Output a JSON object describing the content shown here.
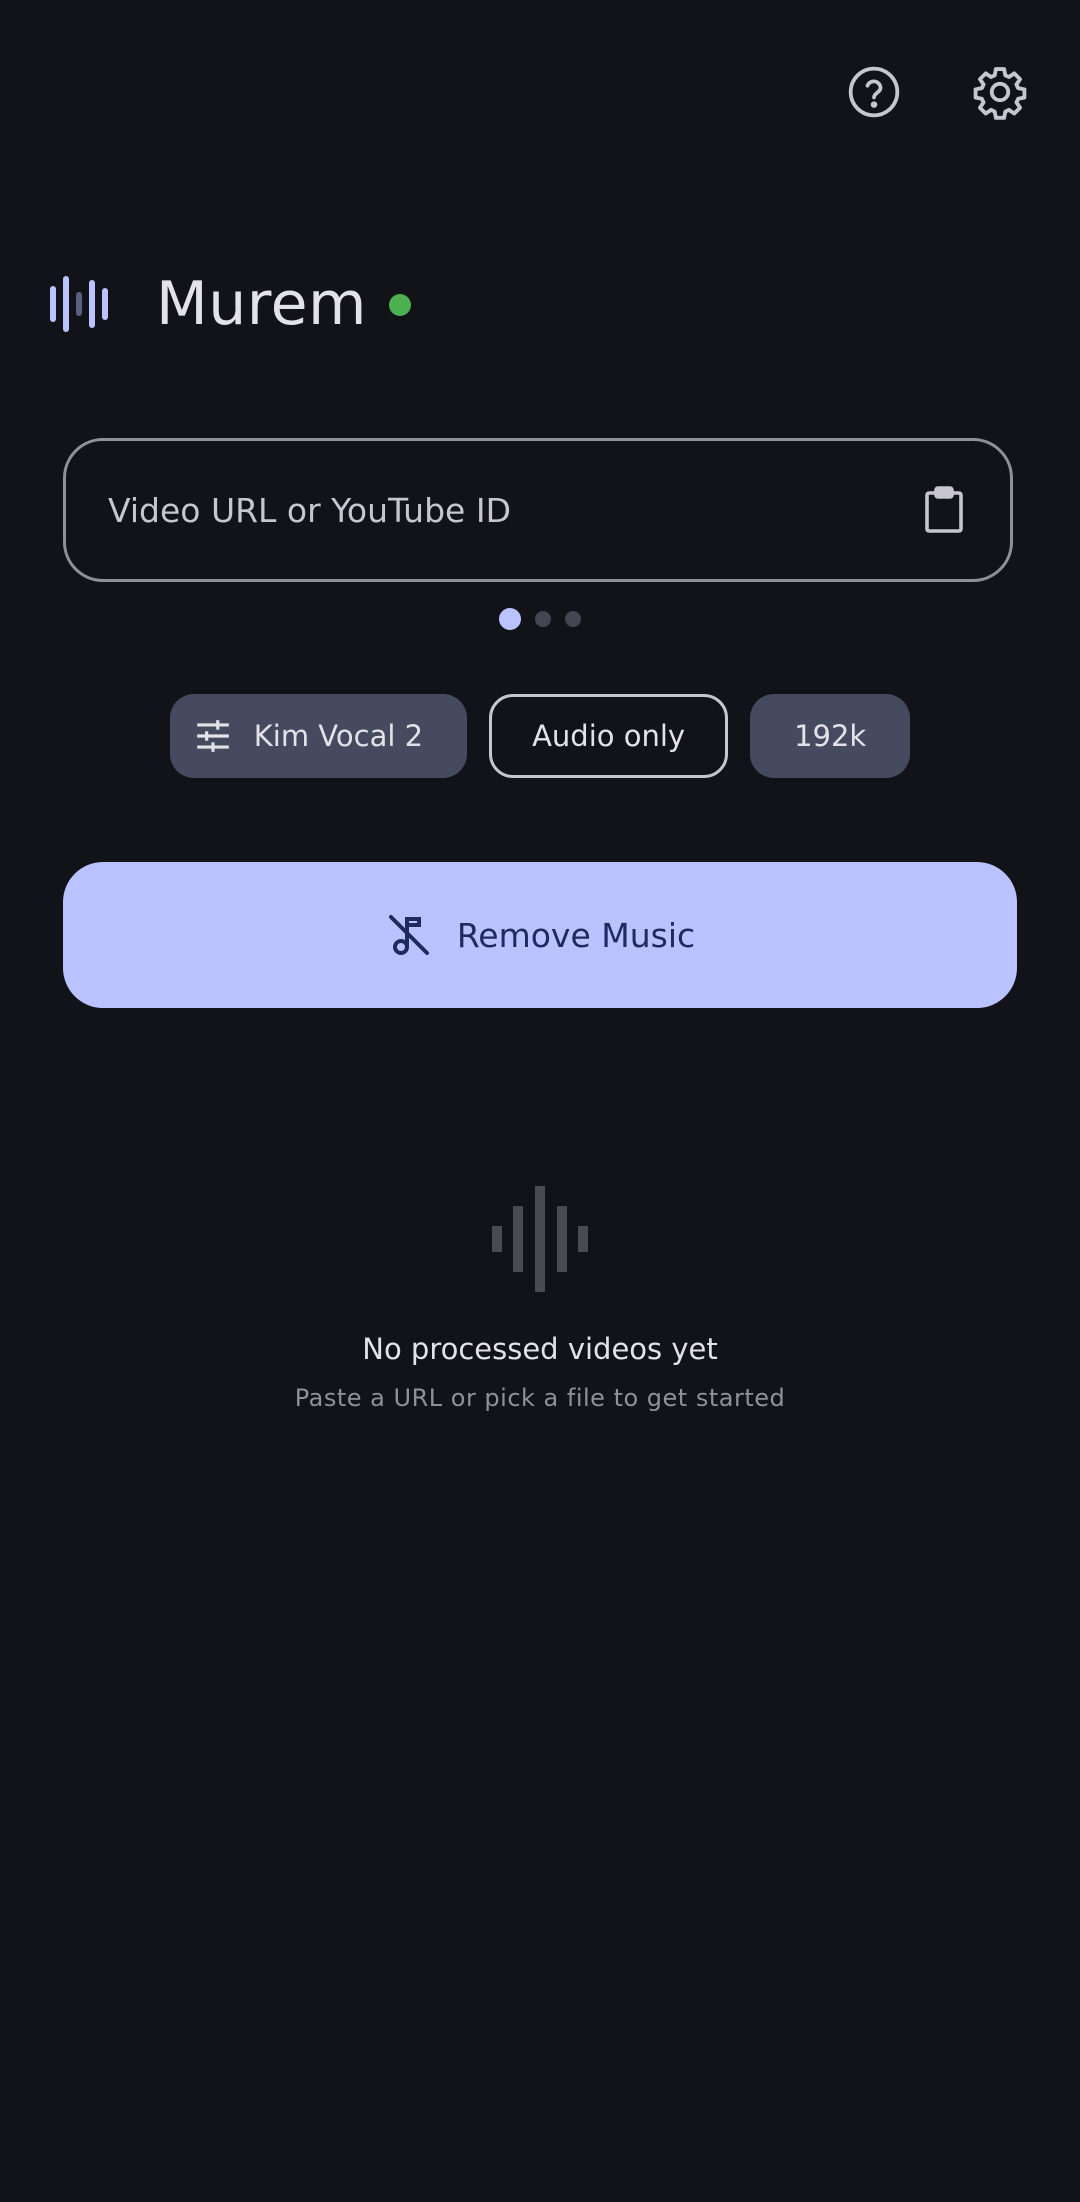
{
  "header": {
    "title": "Murem",
    "status_color": "#4caf50"
  },
  "top_actions": {
    "help_icon": "help-circle-icon",
    "settings_icon": "gear-icon"
  },
  "url_input": {
    "placeholder": "Video URL or YouTube ID",
    "value": "",
    "paste_icon": "clipboard-icon"
  },
  "pager": {
    "count": 3,
    "active_index": 0
  },
  "chips": {
    "model_label": "Kim Vocal 2",
    "model_icon": "tune-sliders-icon",
    "audio_only_label": "Audio only",
    "bitrate_label": "192k"
  },
  "primary_action": {
    "label": "Remove Music",
    "icon": "music-off-icon"
  },
  "empty_state": {
    "icon": "waveform-icon",
    "title": "No processed videos yet",
    "subtitle": "Paste a URL or pick a file to get started"
  },
  "colors": {
    "background": "#121318",
    "accent": "#bac3ff",
    "chip_filled": "#454a5f",
    "on_accent": "#1f2a5e"
  }
}
